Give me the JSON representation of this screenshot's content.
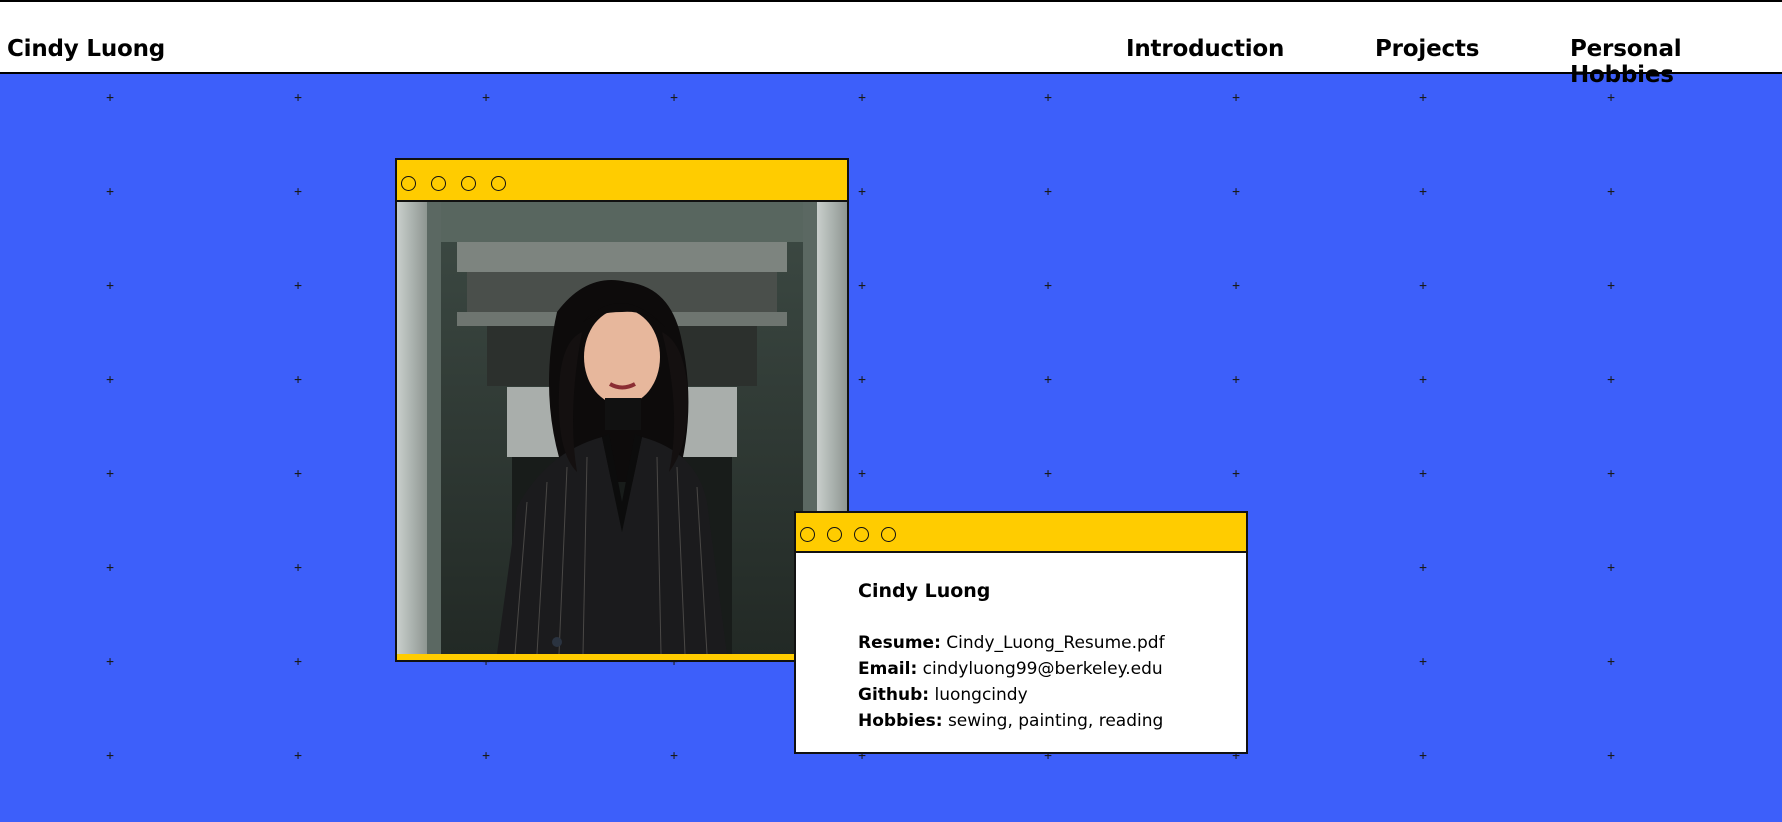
{
  "header": {
    "brand": "Cindy Luong",
    "nav": [
      {
        "label": "Introduction"
      },
      {
        "label": "Projects"
      },
      {
        "label": "Personal Hobbies"
      }
    ]
  },
  "profile_card": {
    "name": "Cindy Luong",
    "rows": [
      {
        "label": "Resume:",
        "value": "Cindy_Luong_Resume.pdf"
      },
      {
        "label": "Email:",
        "value": "cindyluong99@berkeley.edu"
      },
      {
        "label": "Github:",
        "value": "luongcindy"
      },
      {
        "label": "Hobbies:",
        "value": "sewing, painting, reading"
      }
    ]
  },
  "colors": {
    "background": "#3d5ffa",
    "window_titlebar": "#ffcc00",
    "header_bg": "#ffffff"
  },
  "icons": {
    "window_controls": "circle-outline",
    "grid_marker": "plus-icon"
  }
}
